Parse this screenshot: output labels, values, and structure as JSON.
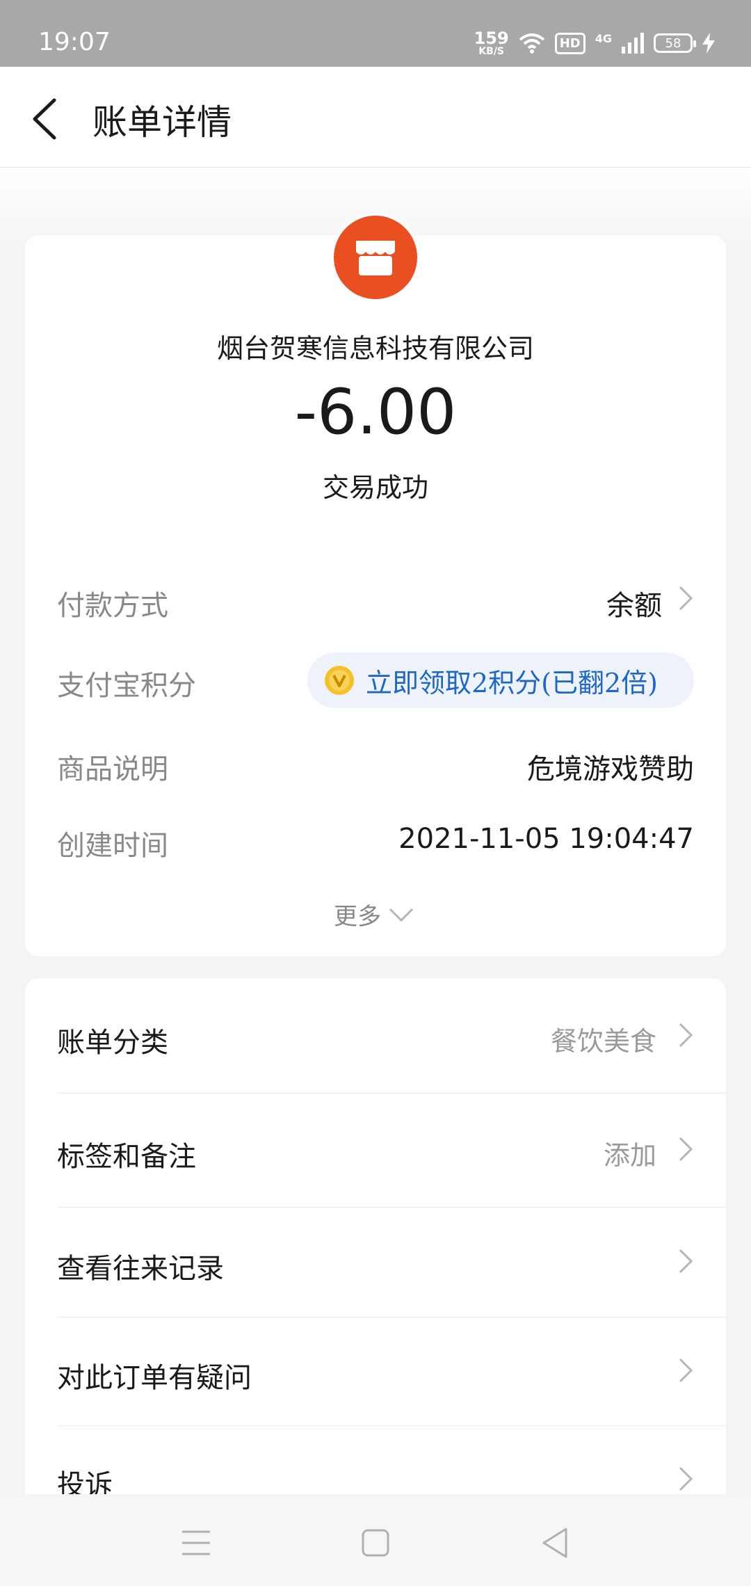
{
  "status_bar": {
    "time": "19:07",
    "net_speed": "159",
    "net_unit": "KB/S",
    "hd": "HD",
    "network": "4G",
    "battery": "58"
  },
  "header": {
    "title": "账单详情"
  },
  "merchant": {
    "name": "烟台贺寒信息科技有限公司",
    "amount": "-6.00",
    "status": "交易成功",
    "logo_color": "#e94f21"
  },
  "details": {
    "payment_method_label": "付款方式",
    "payment_method_value": "余额",
    "points_label": "支付宝积分",
    "points_action": "立即领取2积分(已翻2倍)",
    "goods_label": "商品说明",
    "goods_value": "危境游戏赞助",
    "created_label": "创建时间",
    "created_value": "2021-11-05 19:04:47",
    "more_label": "更多"
  },
  "actions": {
    "category_label": "账单分类",
    "category_value": "餐饮美食",
    "tags_label": "标签和备注",
    "tags_value": "添加",
    "history_label": "查看往来记录",
    "question_label": "对此订单有疑问",
    "complaint_label": "投诉"
  },
  "colors": {
    "accent_blue": "#1f67c5",
    "merchant_orange": "#e94f21",
    "coin_gold": "#f5c02b"
  }
}
